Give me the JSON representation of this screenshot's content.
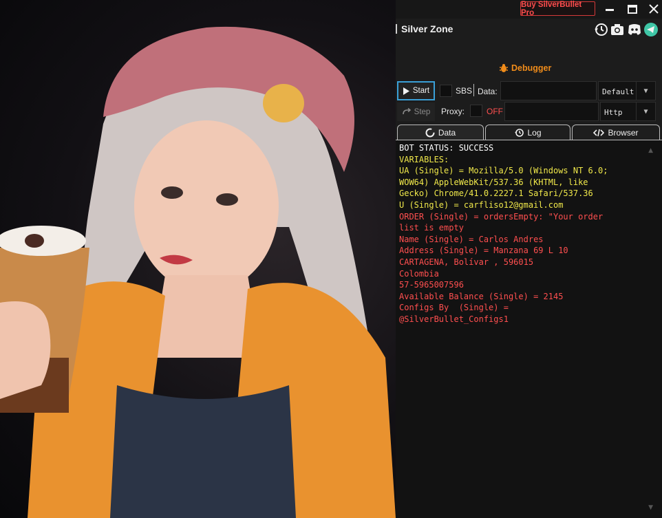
{
  "titlebar": {
    "buy_label": "Buy SilverBullet Pro",
    "minimize_glyph": "▬",
    "maximize_glyph": "▢",
    "close_glyph": "✕"
  },
  "header": {
    "title": "Silver Zone",
    "icons": [
      "history-icon",
      "camera-icon",
      "discord-icon",
      "telegram-icon"
    ]
  },
  "debugger": {
    "label": "Debugger"
  },
  "controls": {
    "start_label": "Start",
    "step_label": "Step",
    "sbs_label": "SBS",
    "data_label": "Data:",
    "data_value": "",
    "data_type": "Default",
    "proxy_label": "Proxy:",
    "proxy_state": "OFF",
    "proxy_value": "",
    "proxy_type": "Http"
  },
  "tabs": [
    {
      "label": "Data",
      "icon": "refresh-icon"
    },
    {
      "label": "Log",
      "icon": "history-icon"
    },
    {
      "label": "Browser",
      "icon": "code-icon"
    }
  ],
  "colors": {
    "accent": "#3aa0d8",
    "brand_red": "#ff4d4d",
    "debugger_orange": "#f08c1a",
    "log_white": "#ffffff",
    "log_yellow": "#f0e84a",
    "log_red": "#ff4f4f"
  },
  "log": {
    "lines": [
      {
        "text": "BOT STATUS: SUCCESS",
        "color": "#ffffff"
      },
      {
        "text": "VARIABLES:",
        "color": "#f0e84a"
      },
      {
        "text": "UA (Single) = Mozilla/5.0 (Windows NT 6.0;",
        "color": "#f0e84a"
      },
      {
        "text": "WOW64) AppleWebKit/537.36 (KHTML, like",
        "color": "#f0e84a"
      },
      {
        "text": "Gecko) Chrome/41.0.2227.1 Safari/537.36",
        "color": "#f0e84a"
      },
      {
        "text": "U (Single) = carfliso12@gmail.com",
        "color": "#f0e84a"
      },
      {
        "text": "ORDER (Single) = ordersEmpty: \"Your order",
        "color": "#ff4f4f"
      },
      {
        "text": "list is empty",
        "color": "#ff4f4f"
      },
      {
        "text": "Name (Single) = Carlos Andres",
        "color": "#ff4f4f"
      },
      {
        "text": "Address (Single) = Manzana 69 L 10",
        "color": "#ff4f4f"
      },
      {
        "text": "CARTAGENA, Bolívar , 596015",
        "color": "#ff4f4f"
      },
      {
        "text": "Colombia",
        "color": "#ff4f4f"
      },
      {
        "text": "57-5965007596",
        "color": "#ff4f4f"
      },
      {
        "text": "Available Balance (Single) = 2145",
        "color": "#ff4f4f"
      },
      {
        "text": "Configs By  (Single) =",
        "color": "#ff4f4f"
      },
      {
        "text": "@SilverBullet_Configs1",
        "color": "#ff4f4f"
      }
    ]
  }
}
